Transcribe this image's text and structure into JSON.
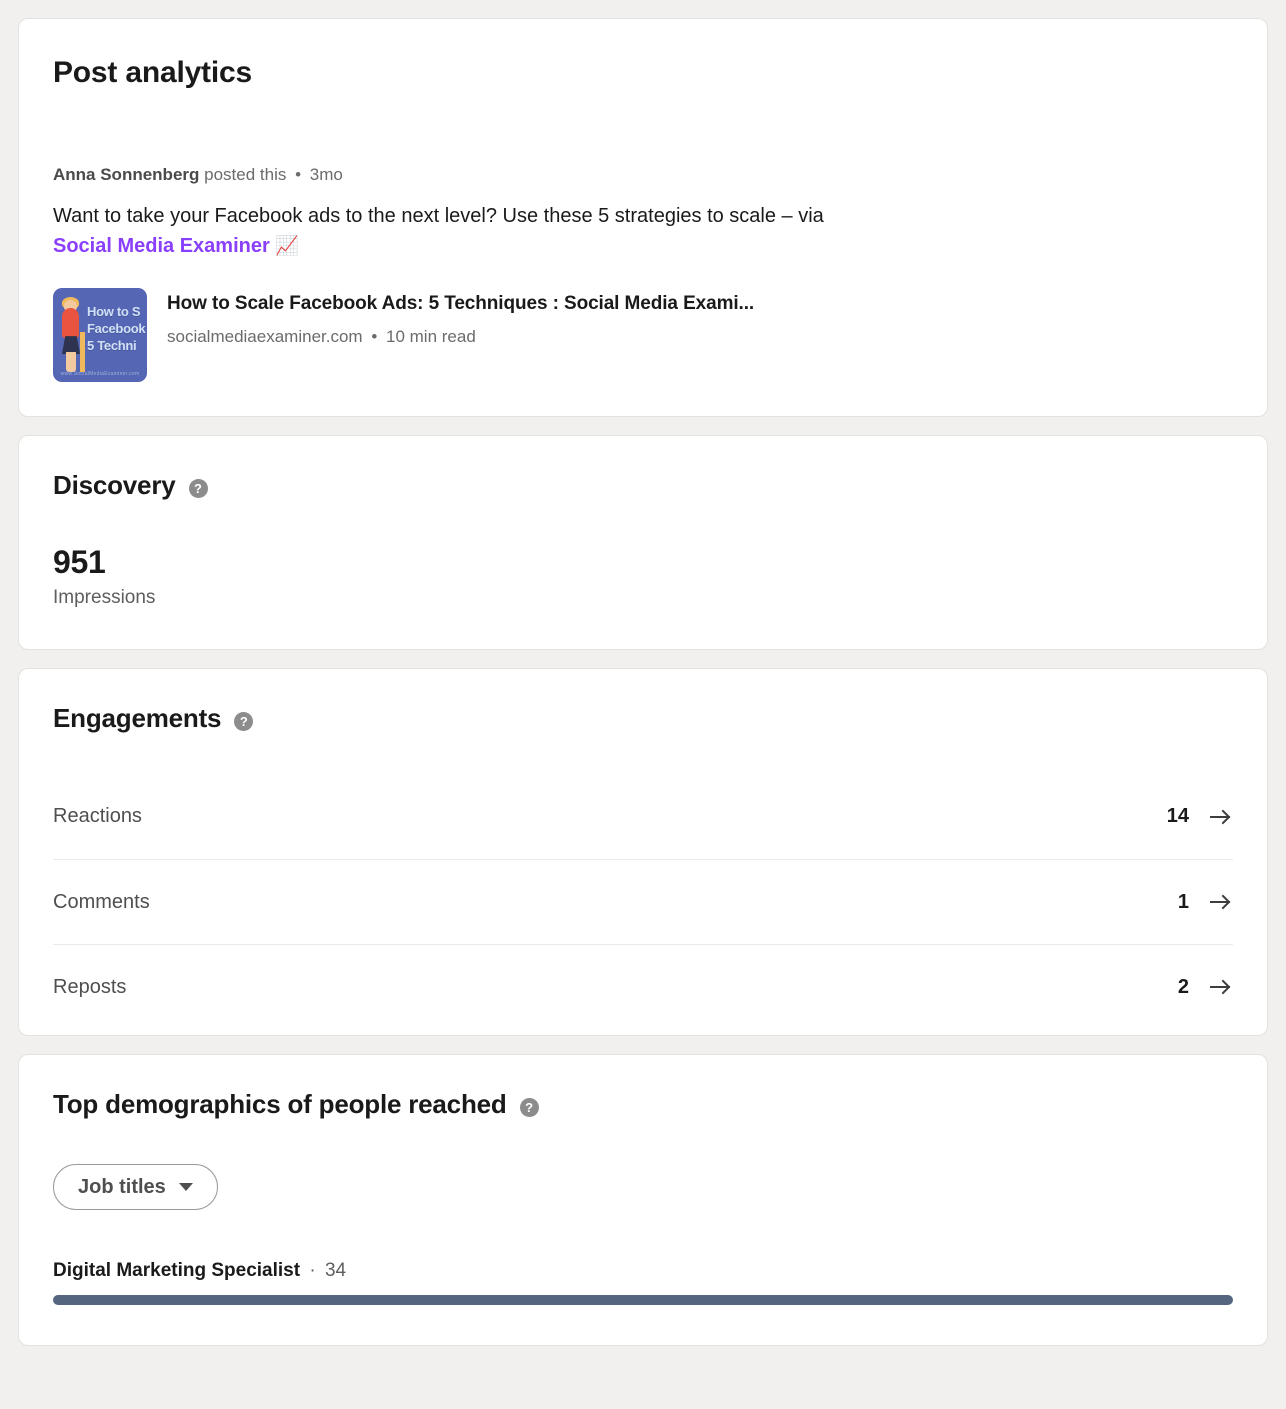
{
  "page": {
    "title": "Post analytics"
  },
  "post": {
    "author": "Anna Sonnenberg",
    "posted_text": "posted this",
    "separator": "•",
    "age": "3mo",
    "body_part1": "Want to take your Facebook ads to the next level? Use these 5 strategies to scale – via ",
    "link_text": "Social Media Examiner",
    "body_emoji": "📈",
    "link_card": {
      "title": "How to Scale Facebook Ads: 5 Techniques : Social Media Exami...",
      "domain": "socialmediaexaminer.com",
      "separator": "•",
      "read_time": "10 min read",
      "thumbnail_text": "How to S\nFacebook\n5 Techni",
      "thumbnail_footer": "www.SocialMediaExaminer.com",
      "thumbnail_bg": "#5566b5"
    }
  },
  "discovery": {
    "title": "Discovery",
    "help_icon": "help-circle-icon",
    "metric_value": "951",
    "metric_label": "Impressions"
  },
  "engagements": {
    "title": "Engagements",
    "help_icon": "help-circle-icon",
    "rows": [
      {
        "label": "Reactions",
        "count": "14",
        "arrow": "arrow-right-icon"
      },
      {
        "label": "Comments",
        "count": "1",
        "arrow": "arrow-right-icon"
      },
      {
        "label": "Reposts",
        "count": "2",
        "arrow": "arrow-right-icon"
      }
    ]
  },
  "demographics": {
    "title": "Top demographics of people reached",
    "help_icon": "help-circle-icon",
    "filter": {
      "label": "Job titles",
      "caret_icon": "chevron-down-icon"
    },
    "items": [
      {
        "name": "Digital Marketing Specialist",
        "separator": "·",
        "value": "34",
        "bar_percent": 100,
        "bar_color": "#55657f"
      }
    ]
  }
}
